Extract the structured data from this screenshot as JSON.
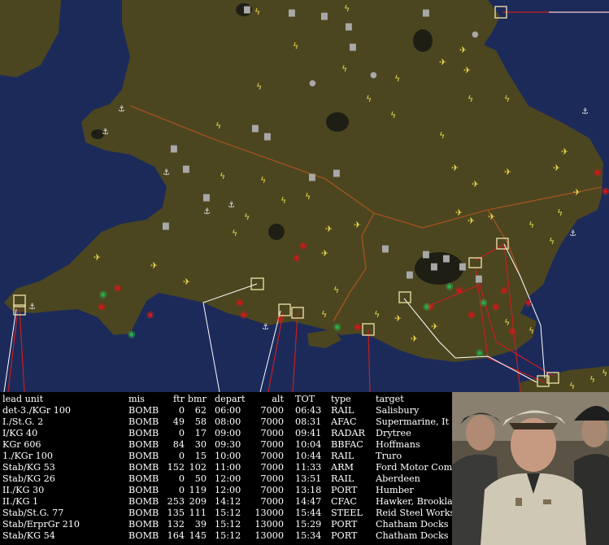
{
  "map": {
    "sea_color": "#1c2a5a",
    "land_color": "#4b4620",
    "border_color": "#a0521e",
    "route_red": "#c81e1e",
    "route_white": "#ffffff",
    "unit_colors": {
      "friendly": "#e8d84a",
      "airfield": "#9a9a9a",
      "german_red": "#cc1a1a",
      "german_green": "#2fa84a",
      "target_box": "#e8d8a0"
    }
  },
  "columns": {
    "unit": "lead unit",
    "mis": "mis",
    "ftr": "ftr",
    "bmr": "bmr",
    "depart": "depart",
    "alt": "alt",
    "tot": "TOT",
    "type": "type",
    "target": "target"
  },
  "missions": [
    {
      "unit": "det-3./KGr 100",
      "mis": "BOMB",
      "ftr": "0",
      "bmr": "62",
      "depart": "06:00",
      "alt": "7000",
      "tot": "06:43",
      "type": "RAIL",
      "target": "Salisbury"
    },
    {
      "unit": "I./St.G. 2",
      "mis": "BOMB",
      "ftr": "49",
      "bmr": "58",
      "depart": "08:00",
      "alt": "7000",
      "tot": "08:31",
      "type": "AFAC",
      "target": "Supermarine, It"
    },
    {
      "unit": "I/KG 40",
      "mis": "BOMB",
      "ftr": "0",
      "bmr": "17",
      "depart": "09:00",
      "alt": "7000",
      "tot": "09:41",
      "type": "RADAR",
      "target": "Drytree"
    },
    {
      "unit": "KGr 606",
      "mis": "BOMB",
      "ftr": "84",
      "bmr": "30",
      "depart": "09:30",
      "alt": "7000",
      "tot": "10:04",
      "type": "BBFAC",
      "target": "Hoffmans"
    },
    {
      "unit": "1./KGr 100",
      "mis": "BOMB",
      "ftr": "0",
      "bmr": "15",
      "depart": "10:00",
      "alt": "7000",
      "tot": "10:44",
      "type": "RAIL",
      "target": "Truro"
    },
    {
      "unit": "Stab/KG 53",
      "mis": "BOMB",
      "ftr": "152",
      "bmr": "102",
      "depart": "11:00",
      "alt": "7000",
      "tot": "11:33",
      "type": "ARM",
      "target": "Ford Motor Comp"
    },
    {
      "unit": "Stab/KG 26",
      "mis": "BOMB",
      "ftr": "0",
      "bmr": "50",
      "depart": "12:00",
      "alt": "7000",
      "tot": "13:51",
      "type": "RAIL",
      "target": "Aberdeen"
    },
    {
      "unit": "II./KG 30",
      "mis": "BOMB",
      "ftr": "0",
      "bmr": "119",
      "depart": "12:00",
      "alt": "7000",
      "tot": "13:18",
      "type": "PORT",
      "target": "Humber"
    },
    {
      "unit": "II./KG 1",
      "mis": "BOMB",
      "ftr": "253",
      "bmr": "209",
      "depart": "14:12",
      "alt": "7000",
      "tot": "14:47",
      "type": "CFAC",
      "target": "Hawker, Brookla"
    },
    {
      "unit": "Stab/St.G. 77",
      "mis": "BOMB",
      "ftr": "135",
      "bmr": "111",
      "depart": "15:12",
      "alt": "13000",
      "tot": "15:44",
      "type": "STEEL",
      "target": "Reid Steel Works"
    },
    {
      "unit": "Stab/ErprGr 210",
      "mis": "BOMB",
      "ftr": "132",
      "bmr": "39",
      "depart": "15:12",
      "alt": "13000",
      "tot": "15:29",
      "type": "PORT",
      "target": "Chatham Docks"
    },
    {
      "unit": "Stab/KG 54",
      "mis": "BOMB",
      "ftr": "164",
      "bmr": "145",
      "depart": "15:12",
      "alt": "13000",
      "tot": "15:34",
      "type": "PORT",
      "target": "Chatham Docks"
    }
  ]
}
